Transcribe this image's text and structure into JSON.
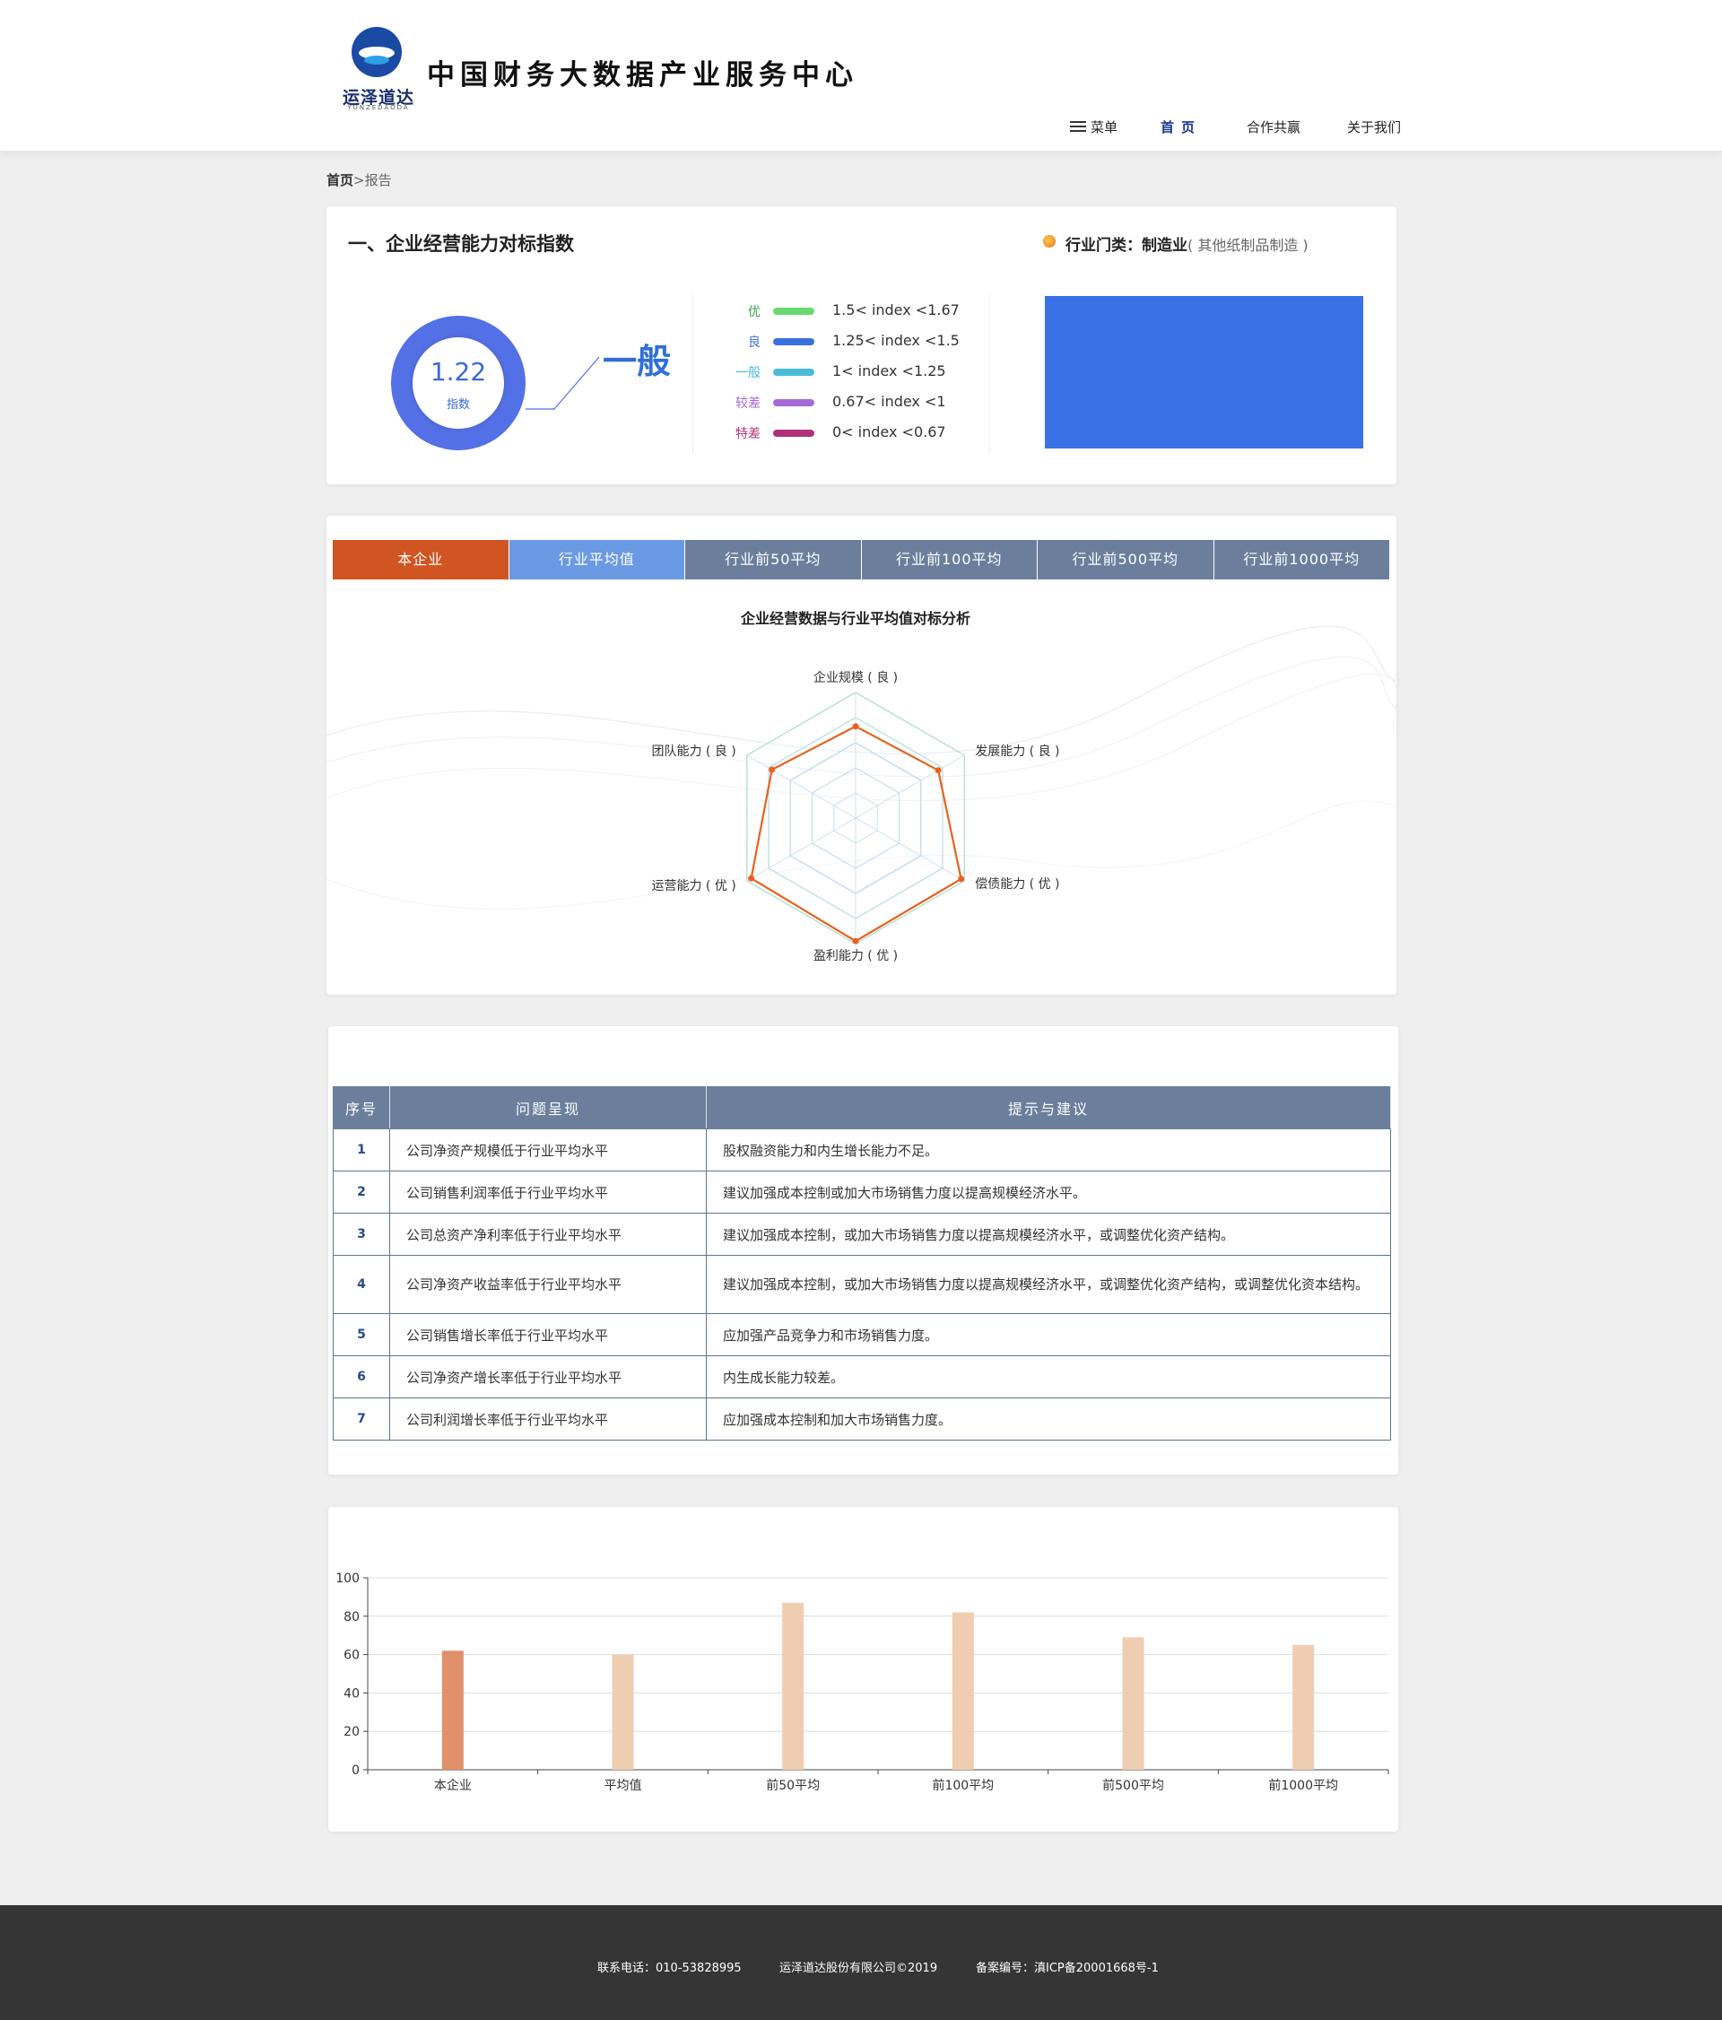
{
  "header": {
    "logo_text": "运泽道达",
    "logo_sub": "YUNZEDAODA",
    "site_title": "中国财务大数据产业服务中心",
    "nav": {
      "menu": "菜单",
      "home": "首页",
      "cooperation": "合作共赢",
      "about": "关于我们"
    }
  },
  "breadcrumb": {
    "home": "首页",
    "sep": ">",
    "current": "报告"
  },
  "index_card": {
    "title": "一、企业经营能力对标指数",
    "industry_label": "行业门类：制造业",
    "industry_sub": "( 其他纸制品制造 )",
    "index_value": "1.22",
    "index_label": "指数",
    "grade": "一般",
    "legend": [
      {
        "name": "优",
        "range": "1.5< index <1.67",
        "color": "#6ad86f"
      },
      {
        "name": "良",
        "range": "1.25< index <1.5",
        "color": "#3a6fe0"
      },
      {
        "name": "一般",
        "range": "1< index <1.25",
        "color": "#4bbcd8"
      },
      {
        "name": "较差",
        "range": "0.67<  index <1",
        "color": "#a56ad6"
      },
      {
        "name": "特差",
        "range": "0< index <0.67",
        "color": "#b0317a"
      }
    ]
  },
  "tabs": [
    {
      "label": "本企业",
      "color": "#d05522"
    },
    {
      "label": "行业平均值",
      "color": "#6b9ae4"
    },
    {
      "label": "行业前50平均",
      "color": "#6b7f9d"
    },
    {
      "label": "行业前100平均",
      "color": "#6b7f9d"
    },
    {
      "label": "行业前500平均",
      "color": "#6b7f9d"
    },
    {
      "label": "行业前1000平均",
      "color": "#6b7f9d"
    }
  ],
  "radar": {
    "title": "企业经营数据与行业平均值对标分析",
    "axes": [
      {
        "label": "企业规模 ( 良 )",
        "value": 0.73
      },
      {
        "label": "发展能力 ( 良 )",
        "value": 0.76
      },
      {
        "label": "偿债能力 ( 优 )",
        "value": 0.97
      },
      {
        "label": "盈利能力 ( 优 )",
        "value": 0.98
      },
      {
        "label": "运营能力 ( 优 )",
        "value": 0.96
      },
      {
        "label": "团队能力 ( 良 )",
        "value": 0.77
      }
    ],
    "series_color": "#e8621e"
  },
  "advice_table": {
    "headers": [
      "序号",
      "问题呈现",
      "提示与建议"
    ],
    "rows": [
      [
        "1",
        "公司净资产规模低于行业平均水平",
        "股权融资能力和内生增长能力不足。"
      ],
      [
        "2",
        "公司销售利润率低于行业平均水平",
        "建议加强成本控制或加大市场销售力度以提高规模经济水平。"
      ],
      [
        "3",
        "公司总资产净利率低于行业平均水平",
        "建议加强成本控制，或加大市场销售力度以提高规模经济水平，或调整优化资产结构。"
      ],
      [
        "4",
        "公司净资产收益率低于行业平均水平",
        "建议加强成本控制，或加大市场销售力度以提高规模经济水平，或调整优化资产结构，或调整优化资本结构。"
      ],
      [
        "5",
        "公司销售增长率低于行业平均水平",
        "应加强产品竞争力和市场销售力度。"
      ],
      [
        "6",
        "公司净资产增长率低于行业平均水平",
        "内生成长能力较差。"
      ],
      [
        "7",
        "公司利润增长率低于行业平均水平",
        "应加强成本控制和加大市场销售力度。"
      ]
    ]
  },
  "chart_data": {
    "type": "bar",
    "categories": [
      "本企业",
      "平均值",
      "前50平均",
      "前100平均",
      "前500平均",
      "前1000平均"
    ],
    "values": [
      62,
      60,
      87,
      82,
      69,
      65
    ],
    "highlight_color": "#e0906a",
    "bar_color": "#efcdb0",
    "ylim": [
      0,
      100
    ],
    "yticks": [
      0,
      20,
      40,
      60,
      80,
      100
    ],
    "grid": true
  },
  "footer": {
    "phone": "联系电话：010-53828995",
    "company": "运泽道达股份有限公司©2019",
    "icp": "备案编号：滇ICP备20001668号-1"
  }
}
